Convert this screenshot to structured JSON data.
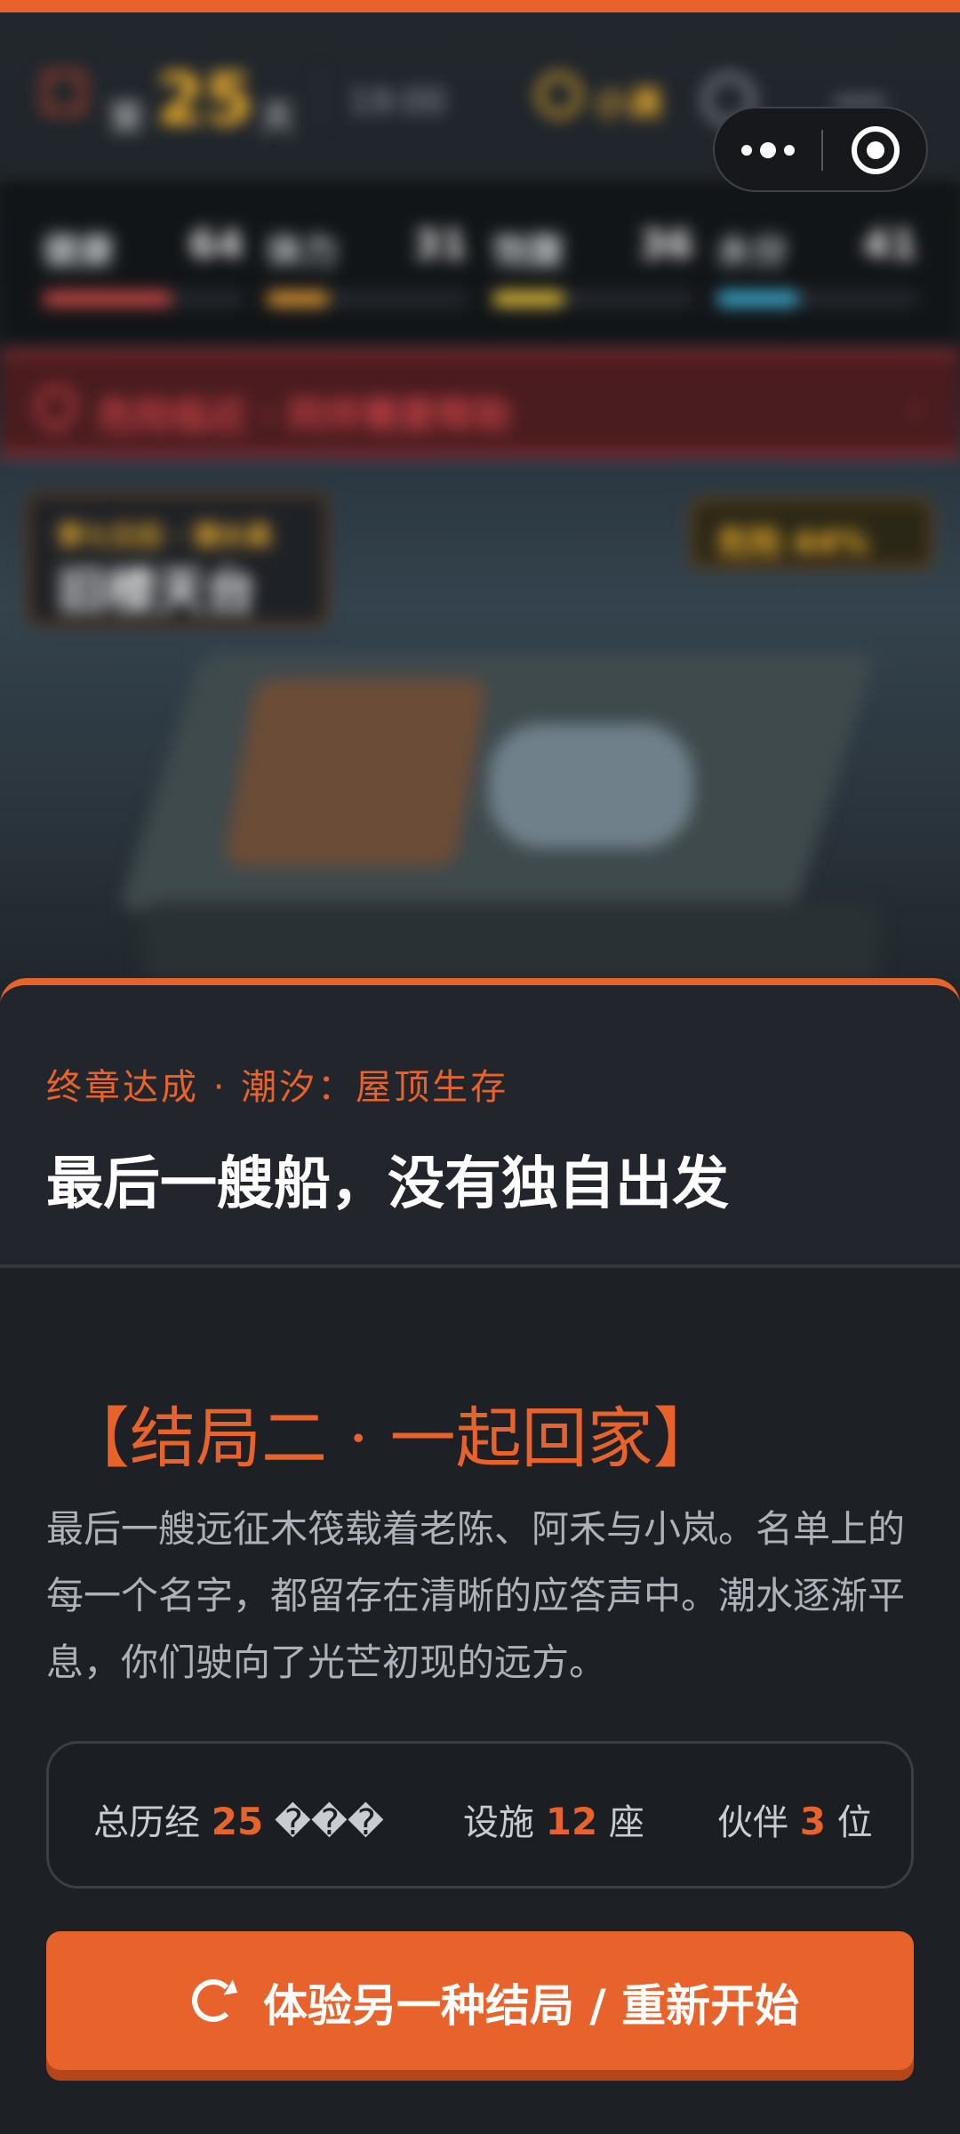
{
  "hud": {
    "day_prefix": "第",
    "day_number": "25",
    "day_suffix": "天",
    "time": "19:00",
    "coins": "小满",
    "stats": [
      {
        "label": "健康",
        "value": "64",
        "fill": 0.64,
        "color": "#d44a46"
      },
      {
        "label": "体力",
        "value": "31",
        "fill": 0.31,
        "color": "#e29a32"
      },
      {
        "label": "饱腹",
        "value": "36",
        "fill": 0.36,
        "color": "#e6c43a"
      },
      {
        "label": "水分",
        "value": "41",
        "fill": 0.41,
        "color": "#3fb3d8"
      }
    ]
  },
  "alert": {
    "text": "危险临近 · 同伴需要帮助",
    "chevron": "›"
  },
  "scene": {
    "location_sub": "第七日后 · 潮水高",
    "location_main": "旧楼天台",
    "risk": "危险 44%"
  },
  "capsule": {
    "more_icon": "more-dots-icon",
    "close_icon": "close-circle-icon"
  },
  "ending": {
    "chapter_tag": "终章达成 · 潮汐：屋顶生存",
    "title": "最后一艘船，没有独自出发",
    "name": "【结局二 · 一起回家】",
    "description": "最后一艘远征木筏载着老陈、阿禾与小岚。名单上的每一个名字，都留存在清晰的应答声中。潮水逐渐平息，你们驶向了光芒初现的远方。",
    "stats": {
      "days_label": "总历经",
      "days_value": "25",
      "days_unit": "���",
      "facilities_label": "设施",
      "facilities_value": "12",
      "facilities_unit": "座",
      "partners_label": "伙伴",
      "partners_value": "3",
      "partners_unit": "位"
    },
    "restart_label": "体验另一种结局 / 重新开始"
  },
  "colors": {
    "accent": "#e8622b",
    "panel_bg": "#1d2025",
    "text_muted": "#aeb2b8"
  }
}
